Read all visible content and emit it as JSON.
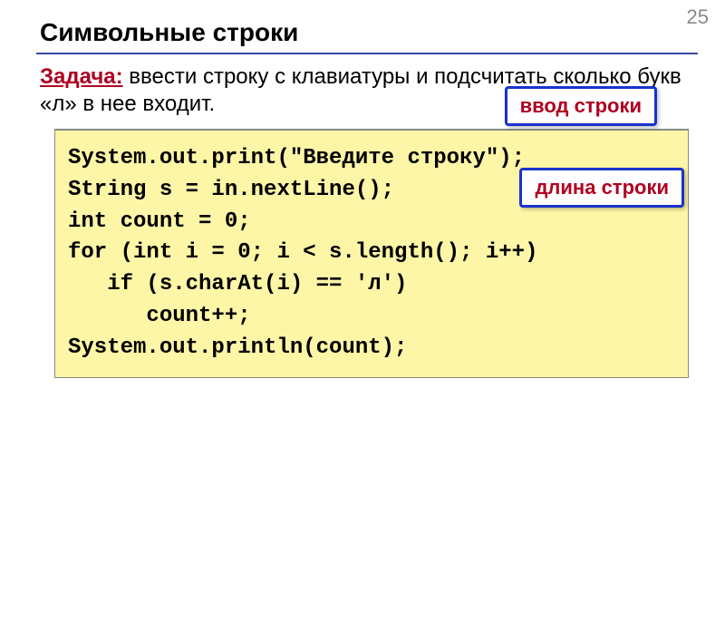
{
  "page_number": "25",
  "title": "Символьные строки",
  "task_label": "Задача:",
  "task_text": " ввести строку с клавиатуры и подсчитать сколько букв «л» в нее входит.",
  "callouts": {
    "input": "ввод строки",
    "length": "длина строки"
  },
  "code": {
    "l1": "System.out.print(\"Введите строку\");",
    "l2": "String s = in.nextLine();",
    "l3": "int count = 0;",
    "l4": "for (int i = 0; i < s.length(); i++)",
    "l5": "   if (s.charAt(i) == 'л')",
    "l6": "      count++;",
    "l7": "System.out.println(count);"
  }
}
